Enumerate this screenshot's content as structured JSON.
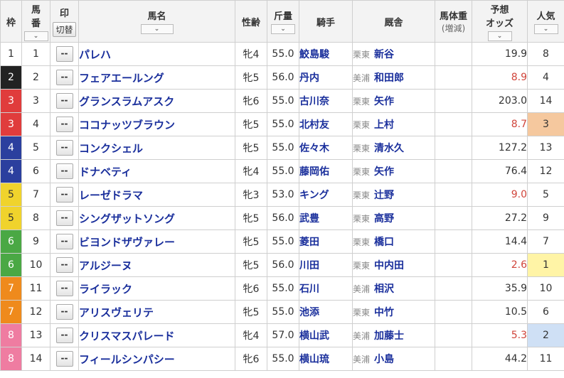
{
  "header": {
    "waku": "枠",
    "umaban": "馬\n番",
    "umaban_l1": "馬",
    "umaban_l2": "番",
    "mark": "印",
    "mark_switch": "切替",
    "name": "馬名",
    "sexage": "性齢",
    "weight": "斤量",
    "jockey": "騎手",
    "stable": "厩舎",
    "bodyweight": "馬体重",
    "bodyweight_sub": "(増減)",
    "odds_l1": "予想",
    "odds_l2": "オッズ",
    "pop": "人気",
    "sort_icon": "chevron-down-icon"
  },
  "colors": {
    "waku": [
      "#ffffff",
      "#222222",
      "#e03c3c",
      "#2b3f9e",
      "#f0d32c",
      "#4aa844",
      "#ef8a1c",
      "#ef7ca1"
    ],
    "odds_hot": "#d0443a",
    "pop1": "#fff4a6",
    "pop2": "#cfe0f5",
    "pop3": "#f5c89e"
  },
  "rows": [
    {
      "waku": "1",
      "num": "1",
      "mark": "--",
      "name": "パレハ",
      "sexage": "牝4",
      "weight": "55.0",
      "jockey": "鮫島駿",
      "area": "栗東",
      "trainer": "新谷",
      "bodyweight": "",
      "odds": "19.9",
      "pop": "8",
      "hot": false
    },
    {
      "waku": "2",
      "num": "2",
      "mark": "--",
      "name": "フェアエールング",
      "sexage": "牝5",
      "weight": "56.0",
      "jockey": "丹内",
      "area": "美浦",
      "trainer": "和田郎",
      "bodyweight": "",
      "odds": "8.9",
      "pop": "4",
      "hot": true
    },
    {
      "waku": "3",
      "num": "3",
      "mark": "--",
      "name": "グランスラムアスク",
      "sexage": "牝6",
      "weight": "55.0",
      "jockey": "古川奈",
      "area": "栗東",
      "trainer": "矢作",
      "bodyweight": "",
      "odds": "203.0",
      "pop": "14",
      "hot": false
    },
    {
      "waku": "3",
      "num": "4",
      "mark": "--",
      "name": "ココナッツブラウン",
      "sexage": "牝5",
      "weight": "55.0",
      "jockey": "北村友",
      "area": "栗東",
      "trainer": "上村",
      "bodyweight": "",
      "odds": "8.7",
      "pop": "3",
      "hot": true
    },
    {
      "waku": "4",
      "num": "5",
      "mark": "--",
      "name": "コンクシェル",
      "sexage": "牝5",
      "weight": "55.0",
      "jockey": "佐々木",
      "area": "栗東",
      "trainer": "清水久",
      "bodyweight": "",
      "odds": "127.2",
      "pop": "13",
      "hot": false
    },
    {
      "waku": "4",
      "num": "6",
      "mark": "--",
      "name": "ドナベティ",
      "sexage": "牝4",
      "weight": "55.0",
      "jockey": "藤岡佑",
      "area": "栗東",
      "trainer": "矢作",
      "bodyweight": "",
      "odds": "76.4",
      "pop": "12",
      "hot": false
    },
    {
      "waku": "5",
      "num": "7",
      "mark": "--",
      "name": "レーゼドラマ",
      "sexage": "牝3",
      "weight": "53.0",
      "jockey": "キング",
      "area": "栗東",
      "trainer": "辻野",
      "bodyweight": "",
      "odds": "9.0",
      "pop": "5",
      "hot": true
    },
    {
      "waku": "5",
      "num": "8",
      "mark": "--",
      "name": "シングザットソング",
      "sexage": "牝5",
      "weight": "56.0",
      "jockey": "武豊",
      "area": "栗東",
      "trainer": "高野",
      "bodyweight": "",
      "odds": "27.2",
      "pop": "9",
      "hot": false
    },
    {
      "waku": "6",
      "num": "9",
      "mark": "--",
      "name": "ビヨンドザヴァレー",
      "sexage": "牝5",
      "weight": "55.0",
      "jockey": "菱田",
      "area": "栗東",
      "trainer": "橋口",
      "bodyweight": "",
      "odds": "14.4",
      "pop": "7",
      "hot": false
    },
    {
      "waku": "6",
      "num": "10",
      "mark": "--",
      "name": "アルジーヌ",
      "sexage": "牝5",
      "weight": "56.0",
      "jockey": "川田",
      "area": "栗東",
      "trainer": "中内田",
      "bodyweight": "",
      "odds": "2.6",
      "pop": "1",
      "hot": true
    },
    {
      "waku": "7",
      "num": "11",
      "mark": "--",
      "name": "ライラック",
      "sexage": "牝6",
      "weight": "55.0",
      "jockey": "石川",
      "area": "美浦",
      "trainer": "相沢",
      "bodyweight": "",
      "odds": "35.9",
      "pop": "10",
      "hot": false
    },
    {
      "waku": "7",
      "num": "12",
      "mark": "--",
      "name": "アリスヴェリテ",
      "sexage": "牝5",
      "weight": "55.0",
      "jockey": "池添",
      "area": "栗東",
      "trainer": "中竹",
      "bodyweight": "",
      "odds": "10.5",
      "pop": "6",
      "hot": false
    },
    {
      "waku": "8",
      "num": "13",
      "mark": "--",
      "name": "クリスマスパレード",
      "sexage": "牝4",
      "weight": "57.0",
      "jockey": "横山武",
      "area": "美浦",
      "trainer": "加藤士",
      "bodyweight": "",
      "odds": "5.3",
      "pop": "2",
      "hot": true
    },
    {
      "waku": "8",
      "num": "14",
      "mark": "--",
      "name": "フィールシンパシー",
      "sexage": "牝6",
      "weight": "55.0",
      "jockey": "横山琉",
      "area": "美浦",
      "trainer": "小島",
      "bodyweight": "",
      "odds": "44.2",
      "pop": "11",
      "hot": false
    }
  ]
}
